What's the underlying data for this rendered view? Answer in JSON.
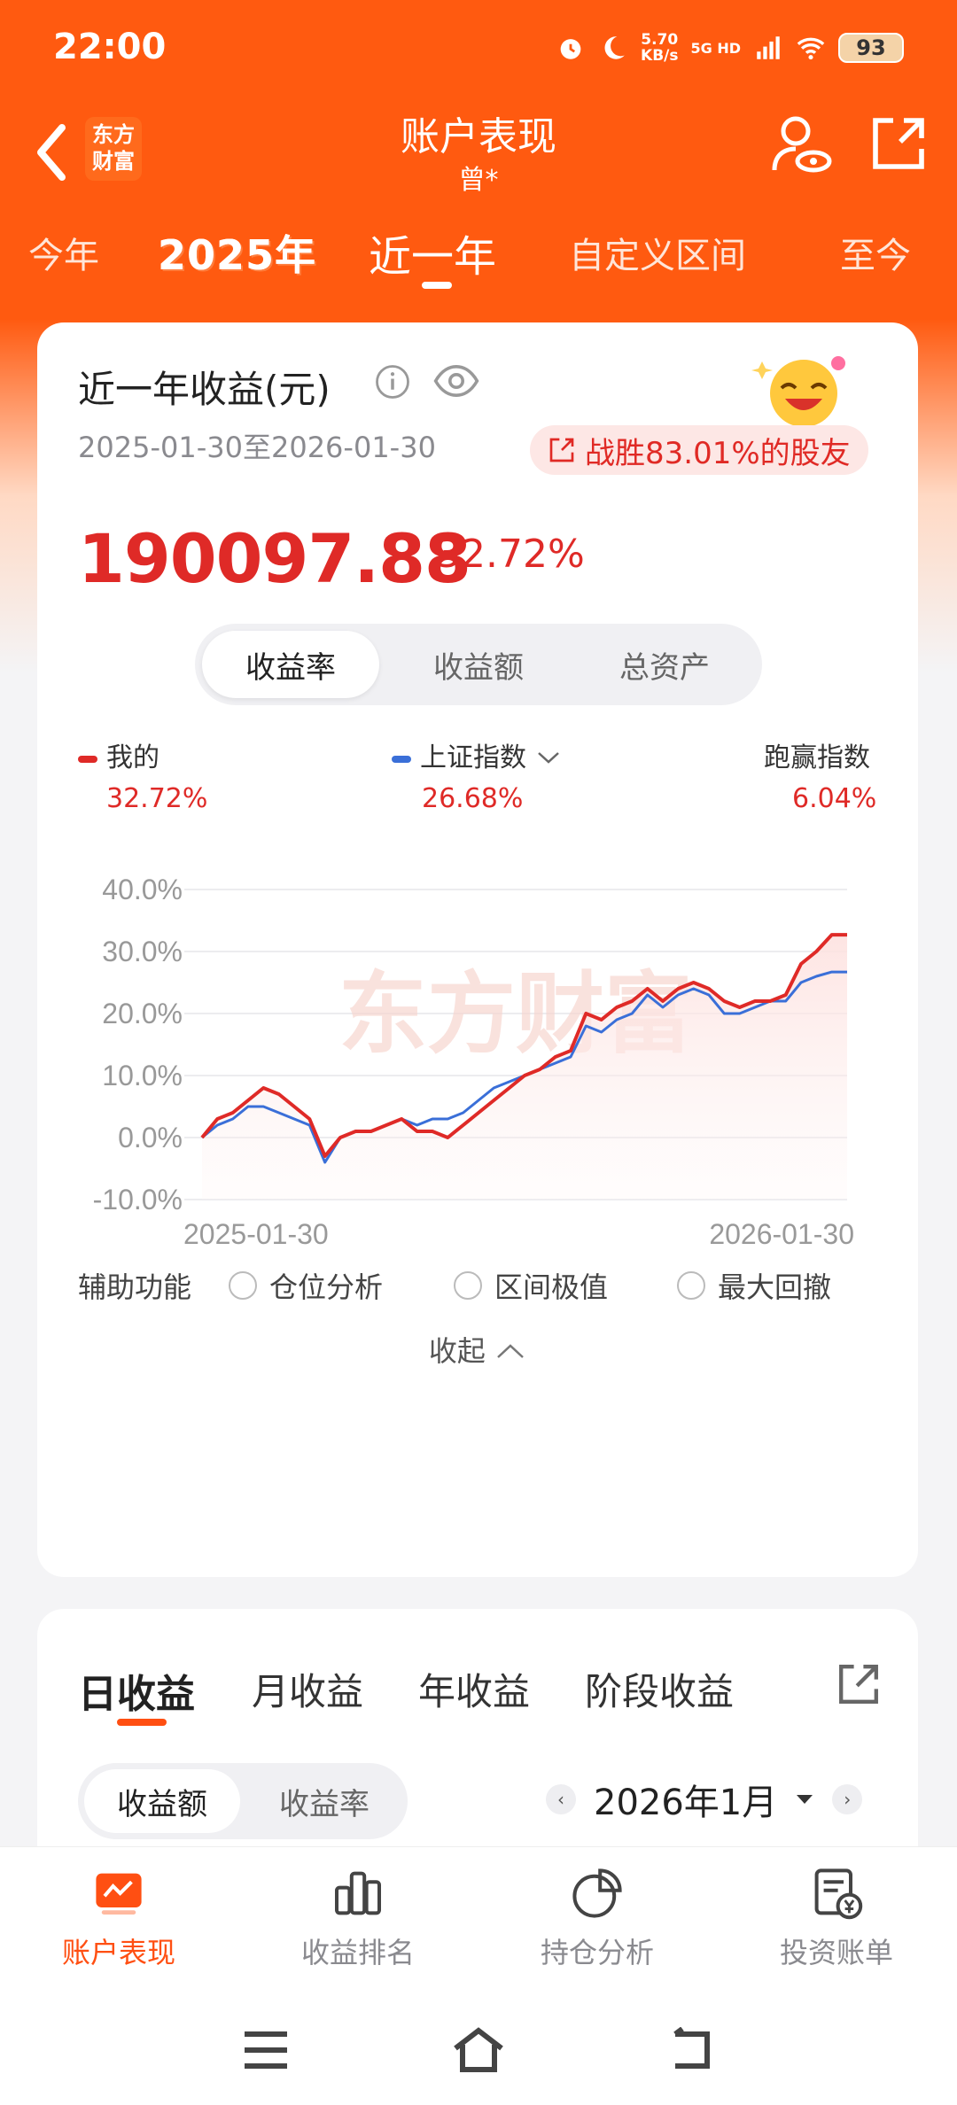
{
  "status_bar": {
    "time": "22:00",
    "net_speed": "5.70",
    "net_unit": "KB/s",
    "signal": "5G HD",
    "battery": "93"
  },
  "nav": {
    "logo_line1": "东方",
    "logo_line2": "财富",
    "title": "账户表现",
    "subtitle": "曾*"
  },
  "period_tabs": [
    {
      "label": "今年"
    },
    {
      "label": "2025年"
    },
    {
      "label": "近一年",
      "active": true
    },
    {
      "label": "自定义区间"
    },
    {
      "label": "至今"
    }
  ],
  "summary": {
    "title": "近一年收益(元)",
    "date_range": "2025-01-30至2026-01-30",
    "beat_text": "战胜83.01%的股友",
    "amount": "190097.88",
    "amount_pct": "32.72%",
    "segments": [
      "收益率",
      "收益额",
      "总资产"
    ],
    "active_segment": "收益率"
  },
  "legend": {
    "mine_label": "我的",
    "mine_value": "32.72%",
    "index_label": "上证指数",
    "index_value": "26.68%",
    "outperform_label": "跑赢指数",
    "outperform_value": "6.04%"
  },
  "colors": {
    "brand": "#ff5a10",
    "mine": "#df2a27",
    "index": "#3a6fd8"
  },
  "chart_data": {
    "type": "line",
    "x_labels": [
      "2025-01-30",
      "2026-01-30"
    ],
    "y_ticks": [
      "40.0%",
      "30.0%",
      "20.0%",
      "10.0%",
      "0.0%",
      "-10.0%"
    ],
    "ylim": [
      -10,
      40
    ],
    "watermark": "东方财富",
    "series": [
      {
        "name": "我的",
        "values": [
          0,
          3,
          4,
          6,
          8,
          7,
          5,
          3,
          -3,
          0,
          1,
          1,
          2,
          3,
          1,
          1,
          0,
          2,
          4,
          6,
          8,
          10,
          11,
          13,
          14,
          20,
          19,
          21,
          22,
          24,
          22,
          24,
          25,
          24,
          22,
          21,
          22,
          22,
          23,
          28,
          30,
          32.7,
          32.7
        ]
      },
      {
        "name": "上证指数",
        "values": [
          0,
          2,
          3,
          5,
          5,
          4,
          3,
          2,
          -4,
          0,
          1,
          1,
          2,
          3,
          2,
          3,
          3,
          4,
          6,
          8,
          9,
          10,
          11,
          12,
          13,
          18,
          17,
          19,
          20,
          23,
          21,
          23,
          24,
          23,
          20,
          20,
          21,
          22,
          22,
          25,
          26,
          26.7,
          26.7
        ]
      }
    ]
  },
  "aux": {
    "label": "辅助功能",
    "options": [
      "仓位分析",
      "区间极值",
      "最大回撤"
    ],
    "collapse": "收起"
  },
  "income": {
    "tabs": [
      "日收益",
      "月收益",
      "年收益",
      "阶段收益"
    ],
    "active_tab": "日收益",
    "segments": [
      "收益额",
      "收益率"
    ],
    "month": "2026年1月"
  },
  "bottom_nav": [
    {
      "label": "账户表现",
      "icon": "chart-icon",
      "active": true
    },
    {
      "label": "收益排名",
      "icon": "bar-rank-icon"
    },
    {
      "label": "持仓分析",
      "icon": "pie-icon"
    },
    {
      "label": "投资账单",
      "icon": "bill-icon"
    }
  ]
}
